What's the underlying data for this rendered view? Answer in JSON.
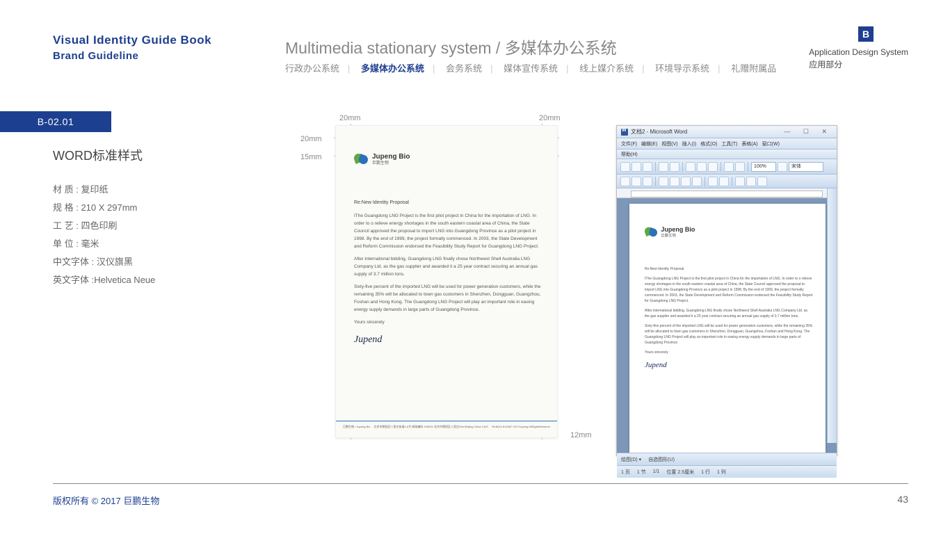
{
  "header": {
    "vi_title": "Visual  Identity  Guide  Book",
    "brand_line": "Brand  Guideline",
    "system_title": "Multimedia stationary system  /  多媒体办公系统",
    "badge": "B",
    "app_system_en": "Application Design System",
    "app_system_cn": "应用部分"
  },
  "nav": {
    "items": [
      "行政办公系统",
      "多媒体办公系统",
      "会务系统",
      "媒体宣传系统",
      "线上媒介系统",
      "环境导示系统",
      "礼赠附属品"
    ],
    "active_index": 1
  },
  "section": {
    "badge": "B-02.01",
    "title": "WORD标准样式"
  },
  "specs": {
    "material": "材 质 : 复印纸",
    "size": "规 格 : 210 X 297mm",
    "process": "工 艺 : 四色印刷",
    "unit": "单 位 : 毫米",
    "font_cn": "中文字体 : 汉仪旗黑",
    "font_en": "英文字体 :Helvetica Neue"
  },
  "margins": {
    "top_left": "20mm",
    "top_right": "20mm",
    "left_1": "20mm",
    "left_2": "15mm",
    "bottom": "12mm"
  },
  "logo": {
    "name_en": "Jupeng Bio",
    "name_cn": "巨鹏生物"
  },
  "document": {
    "subject": "Re:New Identity Proposal",
    "p1": "IThe Guangdong LNG Project is the first pilot project in China for the importation of LNG. In order to o relieve energy shortages in the south eastern coastal area of China, the State Council approved the proposal to import LNG into Guangdong Province as a pilot project in 1998.  By the end of 1999, the project formally commenced. In 2003, the State Development and Reform Commission endorsed the Feasibility Study Report for Guangdong LNG Project.",
    "p2": "After international bidding, Guangdong LNG finally chose Northwest Shell Australia LNG Company Ltd. as the gas supplier and awarded it a 25 year contract securing an annual gas supply of 3.7 million tons.",
    "p3": "Sixty-five percent of the imported LNG will be used for power generation customers, while the remaining 35% will be allocated to town gas customers in Shenzhen, Dongguan, Guangzhou, Foshan and Hong Kong. The Guangdong LNG Project will play an important role in easing energy supply demands in large parts of Guangdong Province.",
    "closing": "Yours sincerely",
    "signature": "Jupend",
    "footer_left": "巨鹏生物 / Jupeng Bio",
    "footer_mid": "北京市朝阳区八里庄街道1-8号  邮政编码 100000  北京市朝阳区八里庄Dist Beijing China 1403",
    "footer_right": "Tel:8610 814567    2017Jupeng AllRightsReserve"
  },
  "word_app": {
    "title": "文档2 - Microsoft Word",
    "menus": [
      "文件(F)",
      "编辑(E)",
      "视图(V)",
      "插入(I)",
      "格式(O)",
      "工具(T)",
      "表格(A)",
      "窗口(W)"
    ],
    "help": "帮助(H)",
    "zoom": "100%",
    "font": "宋体",
    "status": {
      "page": "1 页",
      "sec": "1 节",
      "pages": "1/1",
      "pos": "位置 2.5厘米",
      "line": "1 行",
      "col": "1 列",
      "shape": "自选图形(U)"
    }
  },
  "footer": {
    "copyright": "版权所有 ©    2017    巨鹏生物",
    "page": "43"
  }
}
